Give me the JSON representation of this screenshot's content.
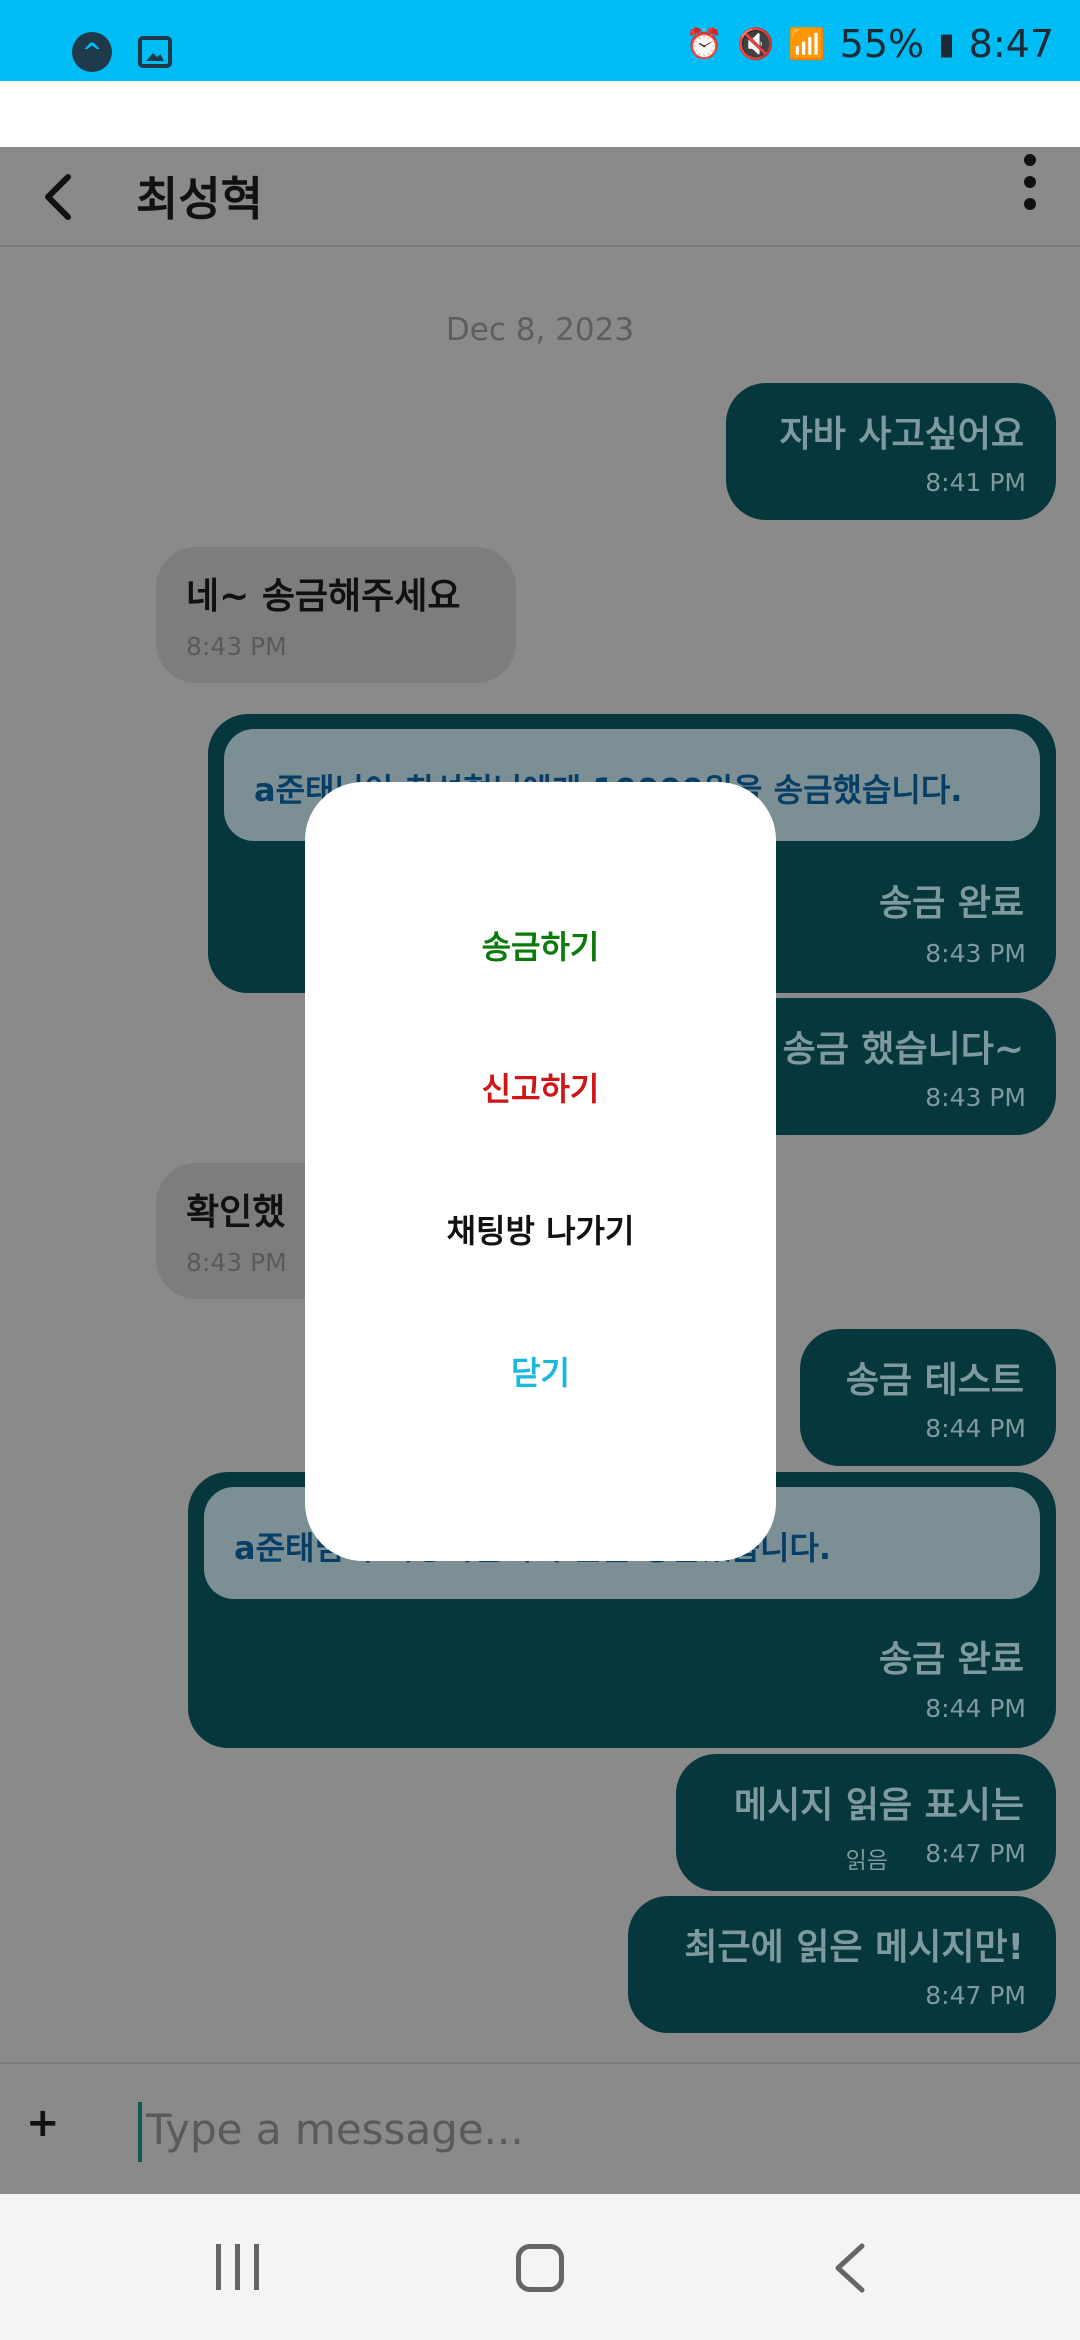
{
  "status_bar": {
    "battery": "55%",
    "time": "8:47"
  },
  "header": {
    "title": "최성혁"
  },
  "chat": {
    "date": "Dec 8, 2023",
    "messages": [
      {
        "direction": "out",
        "text": "자바 사고싶어요",
        "time": "8:41 PM"
      },
      {
        "direction": "in",
        "text": "네~ 송금해주세요",
        "time": "8:43 PM"
      },
      {
        "direction": "out",
        "notice": "a준태님이 최성혁님에게 10000원을 송금했습니다.",
        "text": "송금 완료",
        "time": "8:43 PM"
      },
      {
        "direction": "out",
        "text": "송금 했습니다~",
        "time": "8:43 PM"
      },
      {
        "direction": "in",
        "text": "확인했",
        "time": "8:43 PM"
      },
      {
        "direction": "out",
        "text": "송금 테스트",
        "time": "8:44 PM"
      },
      {
        "direction": "out",
        "notice": "a준태님이 최성혁님에게 원을 송금했습니다.",
        "text": "송금 완료",
        "time": "8:44 PM"
      },
      {
        "direction": "out",
        "text": "메시지 읽음 표시는",
        "read": "읽음",
        "time": "8:47 PM"
      },
      {
        "direction": "out",
        "text": "최근에 읽은 메시지만!",
        "time": "8:47 PM"
      }
    ]
  },
  "input": {
    "plus": "+",
    "placeholder": "Type a message..."
  },
  "dialog": {
    "items": [
      {
        "label": "송금하기",
        "color": "#0a7a0a"
      },
      {
        "label": "신고하기",
        "color": "#d01515"
      },
      {
        "label": "채팅방 나가기",
        "color": "#111111"
      },
      {
        "label": "닫기",
        "color": "#1ab8e0"
      }
    ]
  },
  "colors": {
    "status_bar": "#00bcf5",
    "outgoing_bubble": "#05373d",
    "overlay": "#8a8a8a"
  }
}
